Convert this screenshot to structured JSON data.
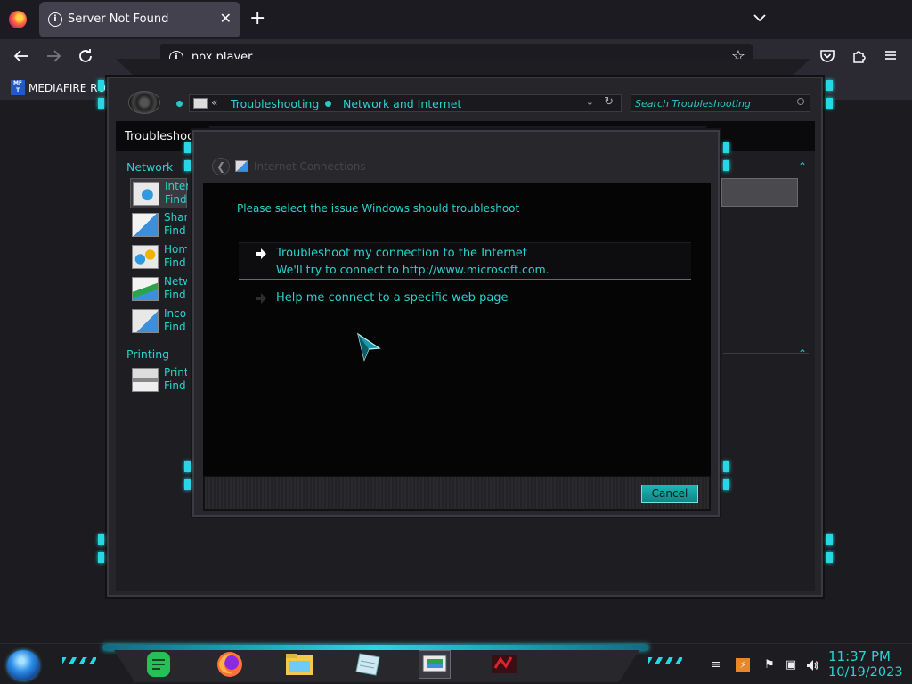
{
  "browser": {
    "tab_title": "Server Not Found",
    "tab_close": "✕",
    "new_tab": "+",
    "tab_list": "⌄",
    "url": "nox player",
    "bookmark": "MEDIAFIRE RO",
    "bookmark_icon_text": "MF T",
    "icons": [
      "firefox-icon",
      "info-icon",
      "back-icon",
      "forward-icon",
      "reload-icon",
      "star-icon",
      "pocket-icon",
      "extensions-icon",
      "menu-icon"
    ]
  },
  "control_panel": {
    "address": {
      "chevron": "«",
      "crumb1": "Troubleshooting",
      "crumb2": "Network and Internet"
    },
    "search_placeholder": "Search Troubleshooting",
    "header": "Troubleshoot",
    "sections": [
      {
        "label": "Network",
        "collapse": "⌃"
      },
      {
        "label": "Printing",
        "collapse": "⌃"
      }
    ],
    "items": [
      {
        "title": "Internet",
        "sub": "Find"
      },
      {
        "title": "Shared",
        "sub": "Find"
      },
      {
        "title": "HomeGroup",
        "sub": "Find"
      },
      {
        "title": "Network",
        "sub": "Find"
      },
      {
        "title": "Incoming",
        "sub": "Find"
      },
      {
        "title": "Printer",
        "sub": "Find"
      }
    ]
  },
  "dialog": {
    "title": "Internet Connections",
    "back": "❮",
    "prompt": "Please select the issue Windows should troubleshoot",
    "options": [
      {
        "title": "Troubleshoot my connection to the Internet",
        "sub": "We'll try to connect to http://www.microsoft.com."
      },
      {
        "title": "Help me connect to a specific web page",
        "sub": ""
      }
    ],
    "cancel": "Cancel"
  },
  "taskbar": {
    "apps": [
      "notes-app",
      "firefox-app",
      "file-explorer-app",
      "notepad-app",
      "control-panel-app",
      "media-app"
    ],
    "tray": {
      "up": "▲",
      "flag": "⚑",
      "network": "▣",
      "volume": "🔊"
    },
    "time": "11:37 PM",
    "date": "10/19/2023"
  },
  "colors": {
    "accent": "#29d3cf",
    "glow": "#27d7e5",
    "browser_bg": "#1c1b22",
    "toolbar_bg": "#2b2a33"
  }
}
